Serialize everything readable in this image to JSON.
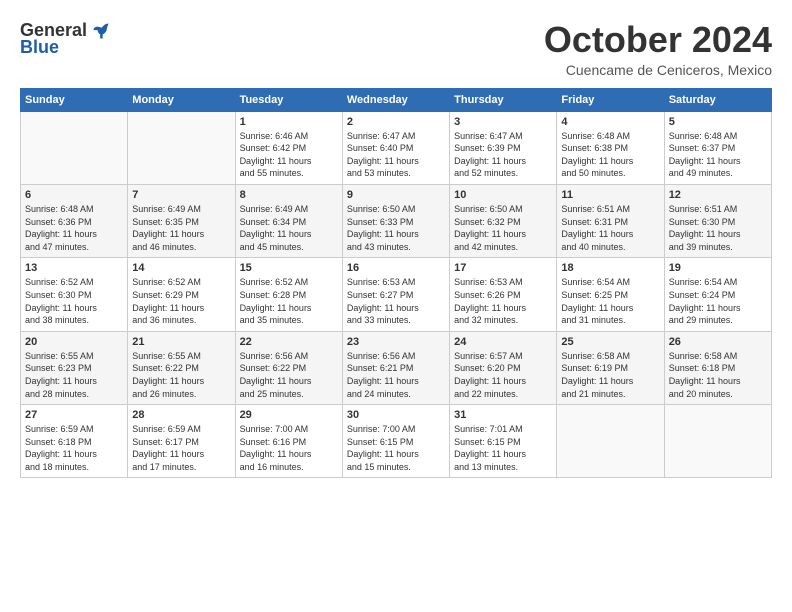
{
  "logo": {
    "general": "General",
    "blue": "Blue"
  },
  "title": "October 2024",
  "location": "Cuencame de Ceniceros, Mexico",
  "days_header": [
    "Sunday",
    "Monday",
    "Tuesday",
    "Wednesday",
    "Thursday",
    "Friday",
    "Saturday"
  ],
  "weeks": [
    [
      {
        "day": "",
        "info": ""
      },
      {
        "day": "",
        "info": ""
      },
      {
        "day": "1",
        "info": "Sunrise: 6:46 AM\nSunset: 6:42 PM\nDaylight: 11 hours\nand 55 minutes."
      },
      {
        "day": "2",
        "info": "Sunrise: 6:47 AM\nSunset: 6:40 PM\nDaylight: 11 hours\nand 53 minutes."
      },
      {
        "day": "3",
        "info": "Sunrise: 6:47 AM\nSunset: 6:39 PM\nDaylight: 11 hours\nand 52 minutes."
      },
      {
        "day": "4",
        "info": "Sunrise: 6:48 AM\nSunset: 6:38 PM\nDaylight: 11 hours\nand 50 minutes."
      },
      {
        "day": "5",
        "info": "Sunrise: 6:48 AM\nSunset: 6:37 PM\nDaylight: 11 hours\nand 49 minutes."
      }
    ],
    [
      {
        "day": "6",
        "info": "Sunrise: 6:48 AM\nSunset: 6:36 PM\nDaylight: 11 hours\nand 47 minutes."
      },
      {
        "day": "7",
        "info": "Sunrise: 6:49 AM\nSunset: 6:35 PM\nDaylight: 11 hours\nand 46 minutes."
      },
      {
        "day": "8",
        "info": "Sunrise: 6:49 AM\nSunset: 6:34 PM\nDaylight: 11 hours\nand 45 minutes."
      },
      {
        "day": "9",
        "info": "Sunrise: 6:50 AM\nSunset: 6:33 PM\nDaylight: 11 hours\nand 43 minutes."
      },
      {
        "day": "10",
        "info": "Sunrise: 6:50 AM\nSunset: 6:32 PM\nDaylight: 11 hours\nand 42 minutes."
      },
      {
        "day": "11",
        "info": "Sunrise: 6:51 AM\nSunset: 6:31 PM\nDaylight: 11 hours\nand 40 minutes."
      },
      {
        "day": "12",
        "info": "Sunrise: 6:51 AM\nSunset: 6:30 PM\nDaylight: 11 hours\nand 39 minutes."
      }
    ],
    [
      {
        "day": "13",
        "info": "Sunrise: 6:52 AM\nSunset: 6:30 PM\nDaylight: 11 hours\nand 38 minutes."
      },
      {
        "day": "14",
        "info": "Sunrise: 6:52 AM\nSunset: 6:29 PM\nDaylight: 11 hours\nand 36 minutes."
      },
      {
        "day": "15",
        "info": "Sunrise: 6:52 AM\nSunset: 6:28 PM\nDaylight: 11 hours\nand 35 minutes."
      },
      {
        "day": "16",
        "info": "Sunrise: 6:53 AM\nSunset: 6:27 PM\nDaylight: 11 hours\nand 33 minutes."
      },
      {
        "day": "17",
        "info": "Sunrise: 6:53 AM\nSunset: 6:26 PM\nDaylight: 11 hours\nand 32 minutes."
      },
      {
        "day": "18",
        "info": "Sunrise: 6:54 AM\nSunset: 6:25 PM\nDaylight: 11 hours\nand 31 minutes."
      },
      {
        "day": "19",
        "info": "Sunrise: 6:54 AM\nSunset: 6:24 PM\nDaylight: 11 hours\nand 29 minutes."
      }
    ],
    [
      {
        "day": "20",
        "info": "Sunrise: 6:55 AM\nSunset: 6:23 PM\nDaylight: 11 hours\nand 28 minutes."
      },
      {
        "day": "21",
        "info": "Sunrise: 6:55 AM\nSunset: 6:22 PM\nDaylight: 11 hours\nand 26 minutes."
      },
      {
        "day": "22",
        "info": "Sunrise: 6:56 AM\nSunset: 6:22 PM\nDaylight: 11 hours\nand 25 minutes."
      },
      {
        "day": "23",
        "info": "Sunrise: 6:56 AM\nSunset: 6:21 PM\nDaylight: 11 hours\nand 24 minutes."
      },
      {
        "day": "24",
        "info": "Sunrise: 6:57 AM\nSunset: 6:20 PM\nDaylight: 11 hours\nand 22 minutes."
      },
      {
        "day": "25",
        "info": "Sunrise: 6:58 AM\nSunset: 6:19 PM\nDaylight: 11 hours\nand 21 minutes."
      },
      {
        "day": "26",
        "info": "Sunrise: 6:58 AM\nSunset: 6:18 PM\nDaylight: 11 hours\nand 20 minutes."
      }
    ],
    [
      {
        "day": "27",
        "info": "Sunrise: 6:59 AM\nSunset: 6:18 PM\nDaylight: 11 hours\nand 18 minutes."
      },
      {
        "day": "28",
        "info": "Sunrise: 6:59 AM\nSunset: 6:17 PM\nDaylight: 11 hours\nand 17 minutes."
      },
      {
        "day": "29",
        "info": "Sunrise: 7:00 AM\nSunset: 6:16 PM\nDaylight: 11 hours\nand 16 minutes."
      },
      {
        "day": "30",
        "info": "Sunrise: 7:00 AM\nSunset: 6:15 PM\nDaylight: 11 hours\nand 15 minutes."
      },
      {
        "day": "31",
        "info": "Sunrise: 7:01 AM\nSunset: 6:15 PM\nDaylight: 11 hours\nand 13 minutes."
      },
      {
        "day": "",
        "info": ""
      },
      {
        "day": "",
        "info": ""
      }
    ]
  ]
}
